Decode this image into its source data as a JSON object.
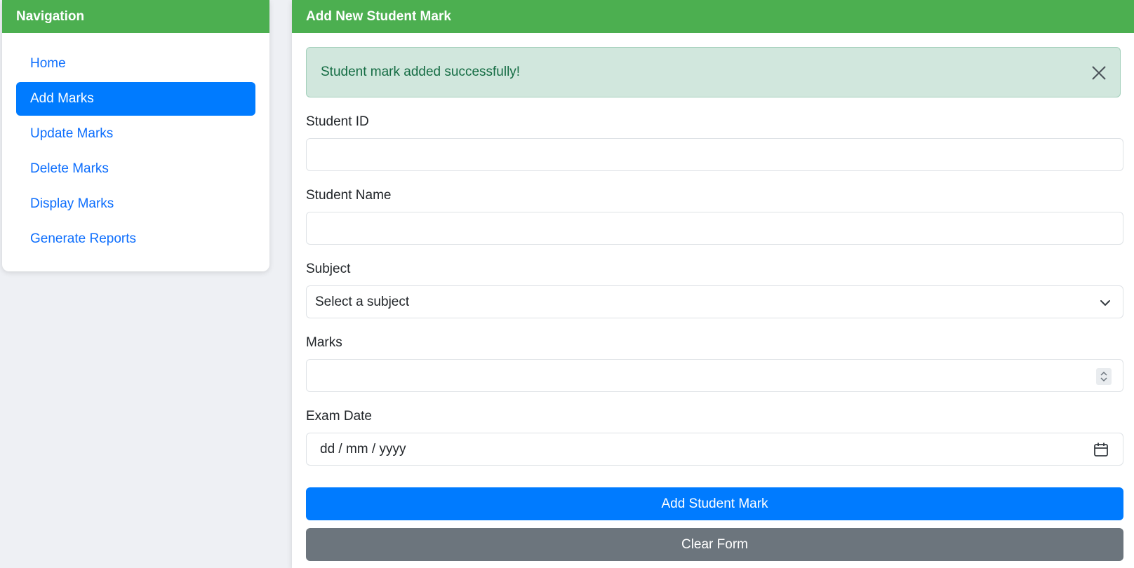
{
  "sidebar": {
    "title": "Navigation",
    "items": [
      {
        "label": "Home"
      },
      {
        "label": "Add Marks"
      },
      {
        "label": "Update Marks"
      },
      {
        "label": "Delete Marks"
      },
      {
        "label": "Display Marks"
      },
      {
        "label": "Generate Reports"
      }
    ],
    "active_index": 1
  },
  "main": {
    "title": "Add New Student Mark",
    "alert": {
      "message": "Student mark added successfully!",
      "type": "success"
    },
    "fields": {
      "student_id": {
        "label": "Student ID",
        "value": ""
      },
      "student_name": {
        "label": "Student Name",
        "value": ""
      },
      "subject": {
        "label": "Subject",
        "selected": "Select a subject"
      },
      "marks": {
        "label": "Marks",
        "value": ""
      },
      "exam_date": {
        "label": "Exam Date",
        "placeholder": "dd / mm / yyyy"
      }
    },
    "buttons": {
      "submit": "Add Student Mark",
      "clear": "Clear Form"
    }
  },
  "colors": {
    "header_green": "#4caf50",
    "primary": "#007bff",
    "secondary": "#6c757d",
    "success_bg": "#d1e7dd"
  },
  "icons": {
    "alert_close": "close-icon",
    "subject_select": "chevron-down-icon",
    "marks_spinner": "spinner-icon",
    "date_picker": "calendar-icon"
  }
}
